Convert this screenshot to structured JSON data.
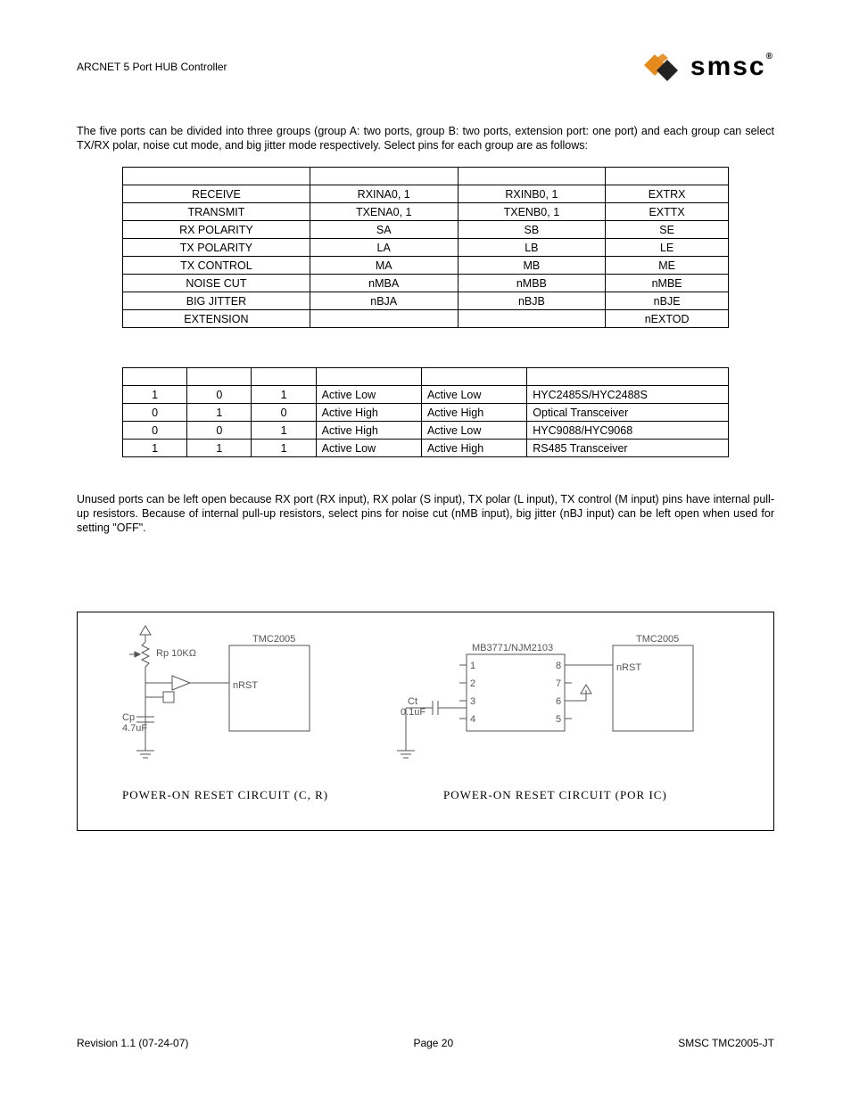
{
  "header": {
    "title": "ARCNET 5 Port HUB Controller",
    "logo_text": "smsc",
    "logo_tm": "®"
  },
  "paragraphs": {
    "p1": "The five ports can be divided into three groups (group A: two ports, group B: two ports, extension port: one port) and each group can select TX/RX polar, noise cut mode, and big jitter mode respectively. Select pins for each group are as follows:",
    "p2": "Unused ports can be left open because RX port (RX input), RX polar (S input), TX polar (L input), TX control (M input) pins have internal pull-up resistors. Because of internal pull-up resistors, select pins for noise cut (nMB input), big jitter (nBJ input) can be left open when used for setting \"OFF\"."
  },
  "table1": {
    "rows": [
      [
        "",
        "",
        "",
        ""
      ],
      [
        "RECEIVE",
        "RXINA0, 1",
        "RXINB0, 1",
        "EXTRX"
      ],
      [
        "TRANSMIT",
        "TXENA0, 1",
        "TXENB0, 1",
        "EXTTX"
      ],
      [
        "RX POLARITY",
        "SA",
        "SB",
        "SE"
      ],
      [
        "TX POLARITY",
        "LA",
        "LB",
        "LE"
      ],
      [
        "TX CONTROL",
        "MA",
        "MB",
        "ME"
      ],
      [
        "NOISE CUT",
        "nMBA",
        "nMBB",
        "nMBE"
      ],
      [
        "BIG JITTER",
        "nBJA",
        "nBJB",
        "nBJE"
      ],
      [
        "EXTENSION",
        "",
        "",
        "nEXTOD"
      ]
    ]
  },
  "table2": {
    "rows": [
      [
        "",
        "",
        "",
        "",
        "",
        ""
      ],
      [
        "1",
        "0",
        "1",
        "Active Low",
        "Active Low",
        "HYC2485S/HYC2488S"
      ],
      [
        "0",
        "1",
        "0",
        "Active High",
        "Active High",
        "Optical Transceiver"
      ],
      [
        "0",
        "0",
        "1",
        "Active High",
        "Active Low",
        "HYC9088/HYC9068"
      ],
      [
        "1",
        "1",
        "1",
        "Active Low",
        "Active High",
        "RS485 Transceiver"
      ]
    ]
  },
  "figure": {
    "left": {
      "rp": "Rp 10KΩ",
      "chip": "TMC2005",
      "pin": "nRST",
      "cp": "Cp\n4.7uF",
      "caption": "POWER-ON RESET CIRCUIT (C, R)"
    },
    "right": {
      "ct": "Ct\n0.1uF",
      "ic": "MB3771/NJM2103",
      "chip": "TMC2005",
      "pin": "nRST",
      "p1": "1",
      "p2": "2",
      "p3": "3",
      "p4": "4",
      "p5": "5",
      "p6": "6",
      "p7": "7",
      "p8": "8",
      "caption": "POWER-ON RESET CIRCUIT (POR IC)"
    }
  },
  "footer": {
    "left": "Revision 1.1 (07-24-07)",
    "center": "Page 20",
    "right": "SMSC TMC2005-JT"
  }
}
